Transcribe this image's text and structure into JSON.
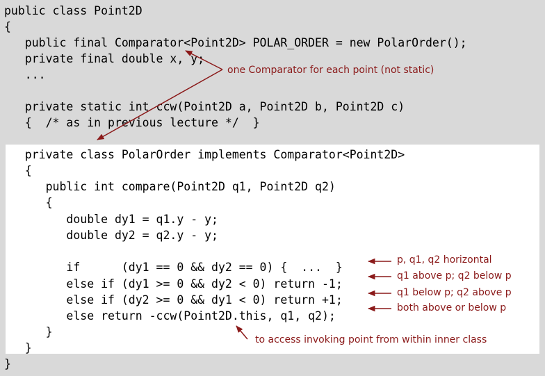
{
  "colors": {
    "background": "#d9d9d9",
    "panel": "#ffffff",
    "code": "#000000",
    "annotation": "#8b1a1a"
  },
  "code_lines": [
    "public class Point2D",
    "{",
    "   public final Comparator<Point2D> POLAR_ORDER = new PolarOrder();",
    "   private final double x, y;",
    "   ...",
    "",
    "   private static int ccw(Point2D a, Point2D b, Point2D c)",
    "   {  /* as in previous lecture */  }",
    "",
    "   private class PolarOrder implements Comparator<Point2D>",
    "   {",
    "      public int compare(Point2D q1, Point2D q2)",
    "      {",
    "         double dy1 = q1.y - y;",
    "         double dy2 = q2.y - y;",
    "",
    "         if      (dy1 == 0 && dy2 == 0) {  ...  }",
    "         else if (dy1 >= 0 && dy2 < 0) return -1;",
    "         else if (dy2 >= 0 && dy1 < 0) return +1;",
    "         else return -ccw(Point2D.this, q1, q2);",
    "      }",
    "   }",
    "}"
  ],
  "annotations": {
    "per_point": "one Comparator for each point (not static)",
    "horizontal": "p, q1, q2 horizontal",
    "above_below": "q1 above p; q2 below p",
    "below_above": "q1 below p; q2 above p",
    "both": "both above or below p",
    "inner_class": "to access invoking point from within inner class"
  }
}
